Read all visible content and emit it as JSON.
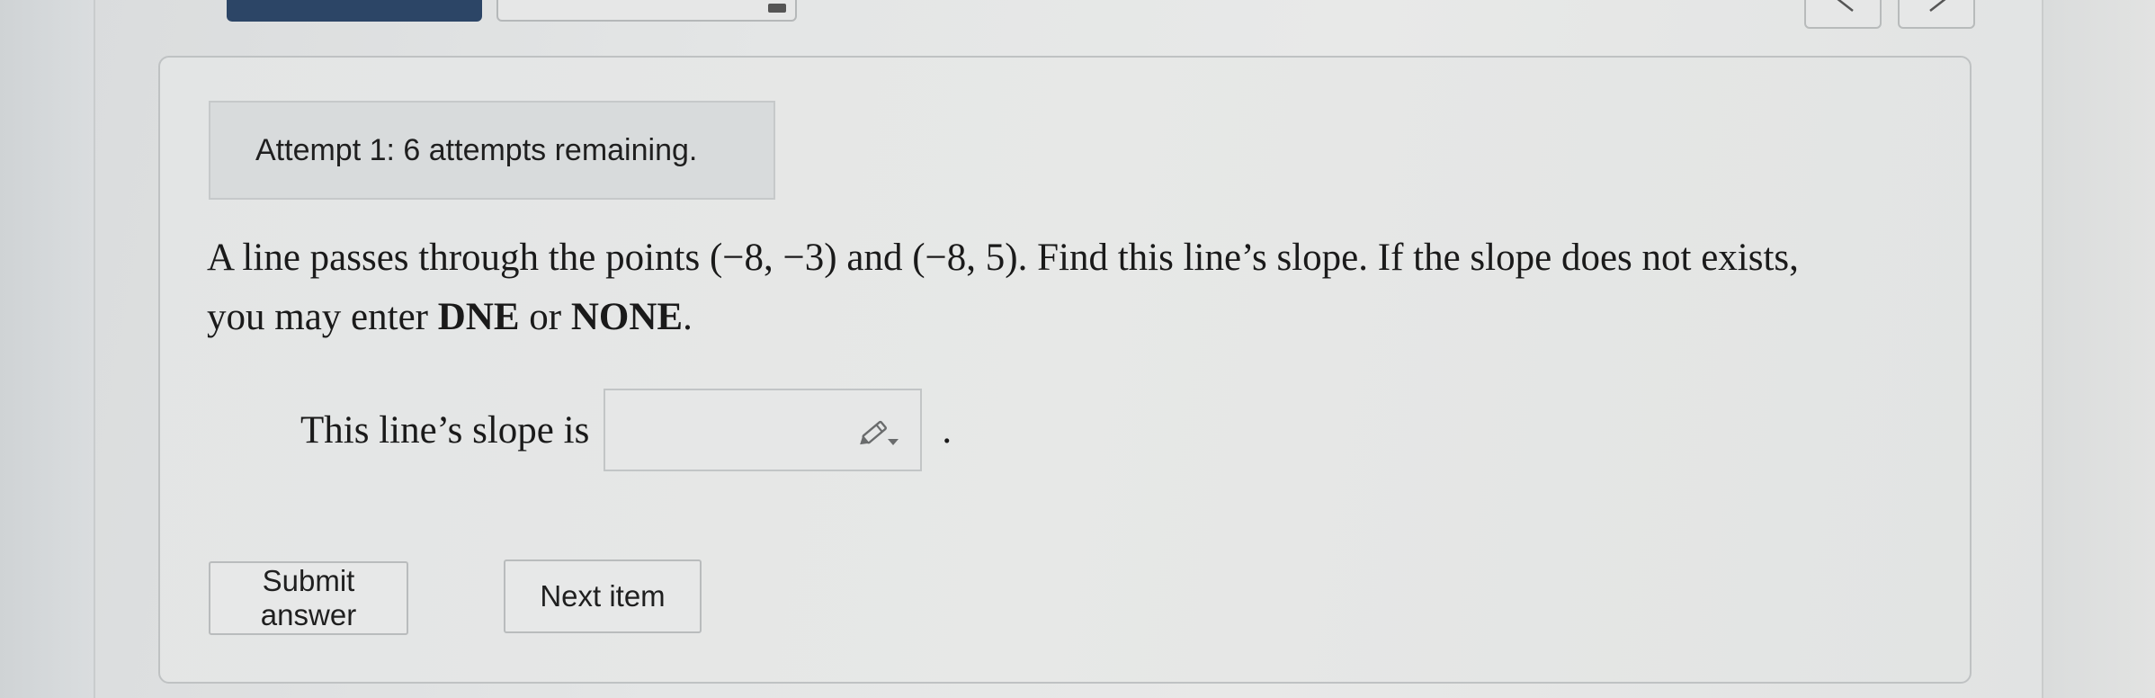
{
  "attempts": {
    "text": "Attempt 1: 6 attempts remaining."
  },
  "question": {
    "line1_prefix": "A line passes through the points ",
    "point1": "(−8, −3)",
    "line1_and": " and ",
    "point2": "(−8, 5)",
    "line1_suffix": ". Find this line’s slope. If the slope does not exists,",
    "line2_prefix": "you may enter ",
    "dne": "DNE",
    "line2_or": " or ",
    "none": "NONE",
    "line2_suffix": "."
  },
  "answer": {
    "label": "This line’s slope is",
    "value": "",
    "period": "."
  },
  "buttons": {
    "submit_label": "Submit answer",
    "next_label": "Next item"
  },
  "icons": {
    "answer_tool": "pencil-dropdown-icon",
    "previous": "chevron-left-icon",
    "next": "chevron-right-icon"
  },
  "colors": {
    "top_submit_button": "#2c4566",
    "banner_background": "#d8dbdc",
    "card_border": "#bfc2c3"
  }
}
